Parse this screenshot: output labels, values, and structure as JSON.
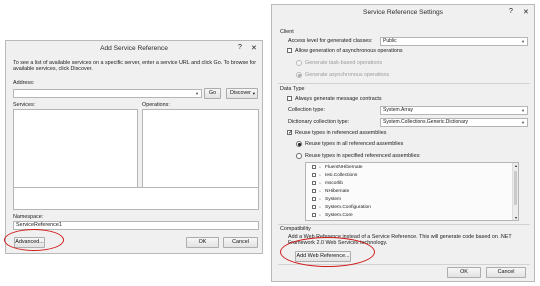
{
  "left_dialog": {
    "title": "Add Service Reference",
    "help_glyph": "?",
    "close_glyph": "✕",
    "instructions": "To see a list of available services on a specific server, enter a service URL and click Go. To browse for available services, click Discover.",
    "address_label": "Address:",
    "address_value": "",
    "go_label": "Go",
    "discover_label": "Discover",
    "services_label": "Services:",
    "operations_label": "Operations:",
    "namespace_label": "Namespace:",
    "namespace_value": "ServiceReference1",
    "advanced_label": "Advanced...",
    "ok_label": "OK",
    "cancel_label": "Cancel"
  },
  "right_dialog": {
    "title": "Service Reference Settings",
    "help_glyph": "?",
    "close_glyph": "✕",
    "client_header": "Client",
    "access_level_label": "Access level for generated classes:",
    "access_level_value": "Public",
    "allow_async_label": "Allow generation of asynchronous operations",
    "allow_async_checked": false,
    "task_based_label": "Generate task-based operations",
    "async_ops_label": "Generate asynchronous operations",
    "data_type_header": "Data Type",
    "always_contracts_label": "Always generate message contracts",
    "always_contracts_checked": false,
    "collection_type_label": "Collection type:",
    "collection_type_value": "System.Array",
    "dictionary_type_label": "Dictionary collection type:",
    "dictionary_type_value": "System.Collections.Generic.Dictionary",
    "reuse_types_label": "Reuse types in referenced assemblies",
    "reuse_types_checked": true,
    "reuse_all_label": "Reuse types in all referenced assemblies",
    "reuse_specified_label": "Reuse types in specified referenced assemblies:",
    "assemblies": [
      {
        "name": "FluentNHibernate"
      },
      {
        "name": "Iesi.Collections"
      },
      {
        "name": "mscorlib"
      },
      {
        "name": "NHibernate"
      },
      {
        "name": "System"
      },
      {
        "name": "System.Configuration"
      },
      {
        "name": "System.Core"
      }
    ],
    "compat_header": "Compatibility",
    "compat_text": "Add a Web Reference instead of a Service Reference. This will generate code based on .NET Framework 2.0 Web Services technology.",
    "add_web_ref_label": "Add Web Reference...",
    "ok_label": "OK",
    "cancel_label": "Cancel"
  },
  "colors": {
    "highlight_circle": "#d11b1b",
    "dialog_bg": "#f0f0f0",
    "title_bar": "#f0f0f0"
  }
}
